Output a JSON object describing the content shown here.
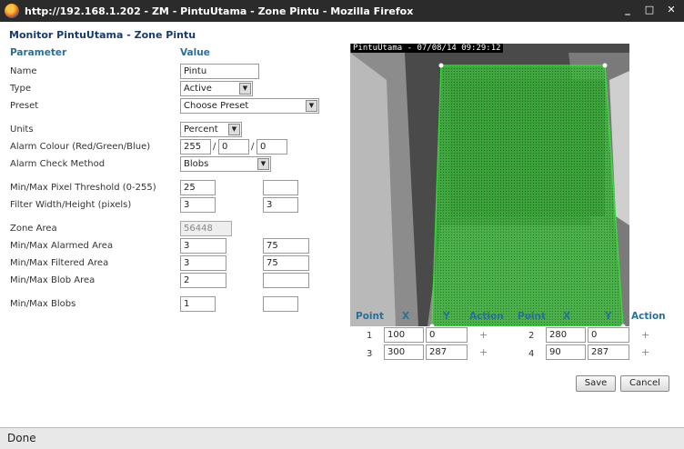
{
  "window": {
    "title": "http://192.168.1.202 - ZM - PintuUtama - Zone Pintu - Mozilla Firefox",
    "controls": [
      "_",
      "□",
      "✕"
    ]
  },
  "page": {
    "heading": "Monitor PintuUtama - Zone Pintu",
    "col_parameter": "Parameter",
    "col_value": "Value"
  },
  "fields": {
    "name": {
      "label": "Name",
      "value": "Pintu"
    },
    "type": {
      "label": "Type",
      "value": "Active"
    },
    "preset": {
      "label": "Preset",
      "value": "Choose Preset"
    },
    "units": {
      "label": "Units",
      "value": "Percent"
    },
    "alarm_colour": {
      "label": "Alarm Colour (Red/Green/Blue)",
      "r": "255",
      "g": "0",
      "b": "0",
      "sep": "/"
    },
    "alarm_check": {
      "label": "Alarm Check Method",
      "value": "Blobs"
    },
    "pixel_threshold": {
      "label": "Min/Max Pixel Threshold (0-255)",
      "min": "25",
      "max": ""
    },
    "filter_size": {
      "label": "Filter Width/Height (pixels)",
      "min": "3",
      "max": "3"
    },
    "zone_area": {
      "label": "Zone Area",
      "value": "56448"
    },
    "alarmed_area": {
      "label": "Min/Max Alarmed Area",
      "min": "3",
      "max": "75"
    },
    "filtered_area": {
      "label": "Min/Max Filtered Area",
      "min": "3",
      "max": "75"
    },
    "blob_area": {
      "label": "Min/Max Blob Area",
      "min": "2",
      "max": ""
    },
    "blobs": {
      "label": "Min/Max Blobs",
      "min": "1",
      "max": ""
    }
  },
  "image": {
    "timestamp": "PintuUtama - 07/08/14 09:29:12"
  },
  "points": {
    "headers": [
      "Point",
      "X",
      "Y",
      "Action",
      "Point",
      "X",
      "Y",
      "Action"
    ],
    "rows": [
      {
        "n": "1",
        "x": "100",
        "y": "0",
        "action": "+"
      },
      {
        "n": "2",
        "x": "280",
        "y": "0",
        "action": "+"
      },
      {
        "n": "3",
        "x": "300",
        "y": "287",
        "action": "+"
      },
      {
        "n": "4",
        "x": "90",
        "y": "287",
        "action": "+"
      }
    ]
  },
  "buttons": {
    "save": "Save",
    "cancel": "Cancel"
  },
  "status": {
    "text": "Done"
  },
  "colors": {
    "zone_fill": "#2ecc2e",
    "heading": "#1a3a6a",
    "column_header": "#2a6f9a"
  }
}
